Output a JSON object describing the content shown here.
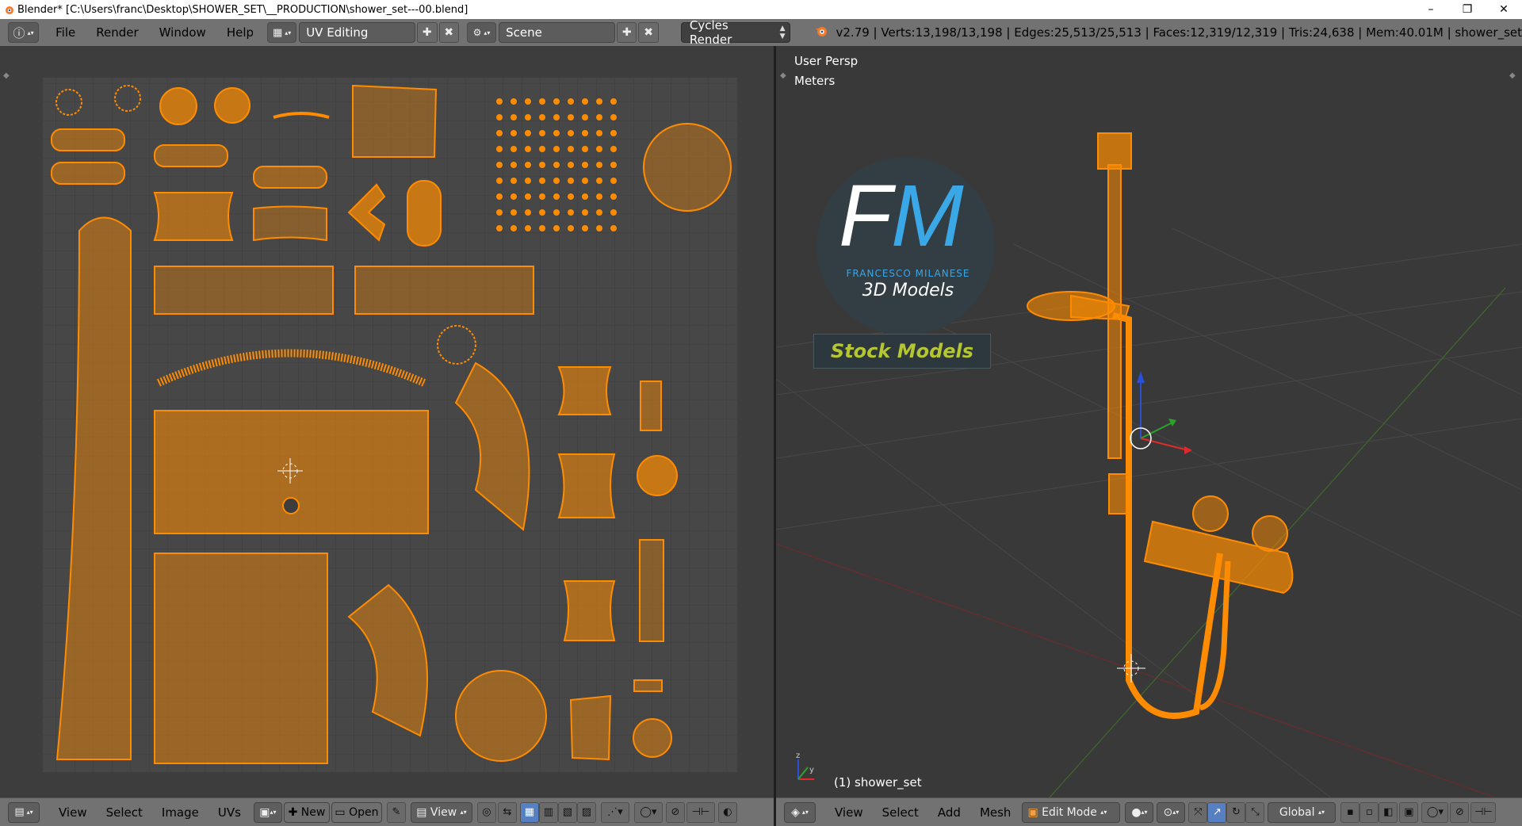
{
  "window": {
    "title": "Blender* [C:\\Users\\franc\\Desktop\\SHOWER_SET\\__PRODUCTION\\shower_set---00.blend]",
    "controls": [
      "–",
      "❐",
      "✕"
    ]
  },
  "infobar": {
    "menus": [
      "File",
      "Render",
      "Window",
      "Help"
    ],
    "screen_layout": "UV Editing",
    "scene": "Scene",
    "render_engine": "Cycles Render",
    "stats": "v2.79 | Verts:13,198/13,198 | Edges:25,513/25,513 | Faces:12,319/12,319 | Tris:24,638 | Mem:40.01M | shower_set"
  },
  "uv_editor": {
    "header_menus": [
      "View",
      "Select",
      "Image",
      "UVs"
    ],
    "new_label": "New",
    "open_label": "Open",
    "view_label": "View",
    "grid_color": "#444444",
    "island_color": "#ff8c00"
  },
  "viewport": {
    "view_label": "User Persp",
    "units_label": "Meters",
    "object_label": "(1) shower_set",
    "logo": {
      "initials_f": "F",
      "initials_m": "M",
      "name": "FRANCESCO MILANESE",
      "tagline": "3D Models",
      "banner": "Stock Models"
    },
    "header_menus": [
      "View",
      "Select",
      "Add",
      "Mesh"
    ],
    "mode": "Edit Mode",
    "orientation": "Global",
    "accent": "#ff8c00"
  }
}
